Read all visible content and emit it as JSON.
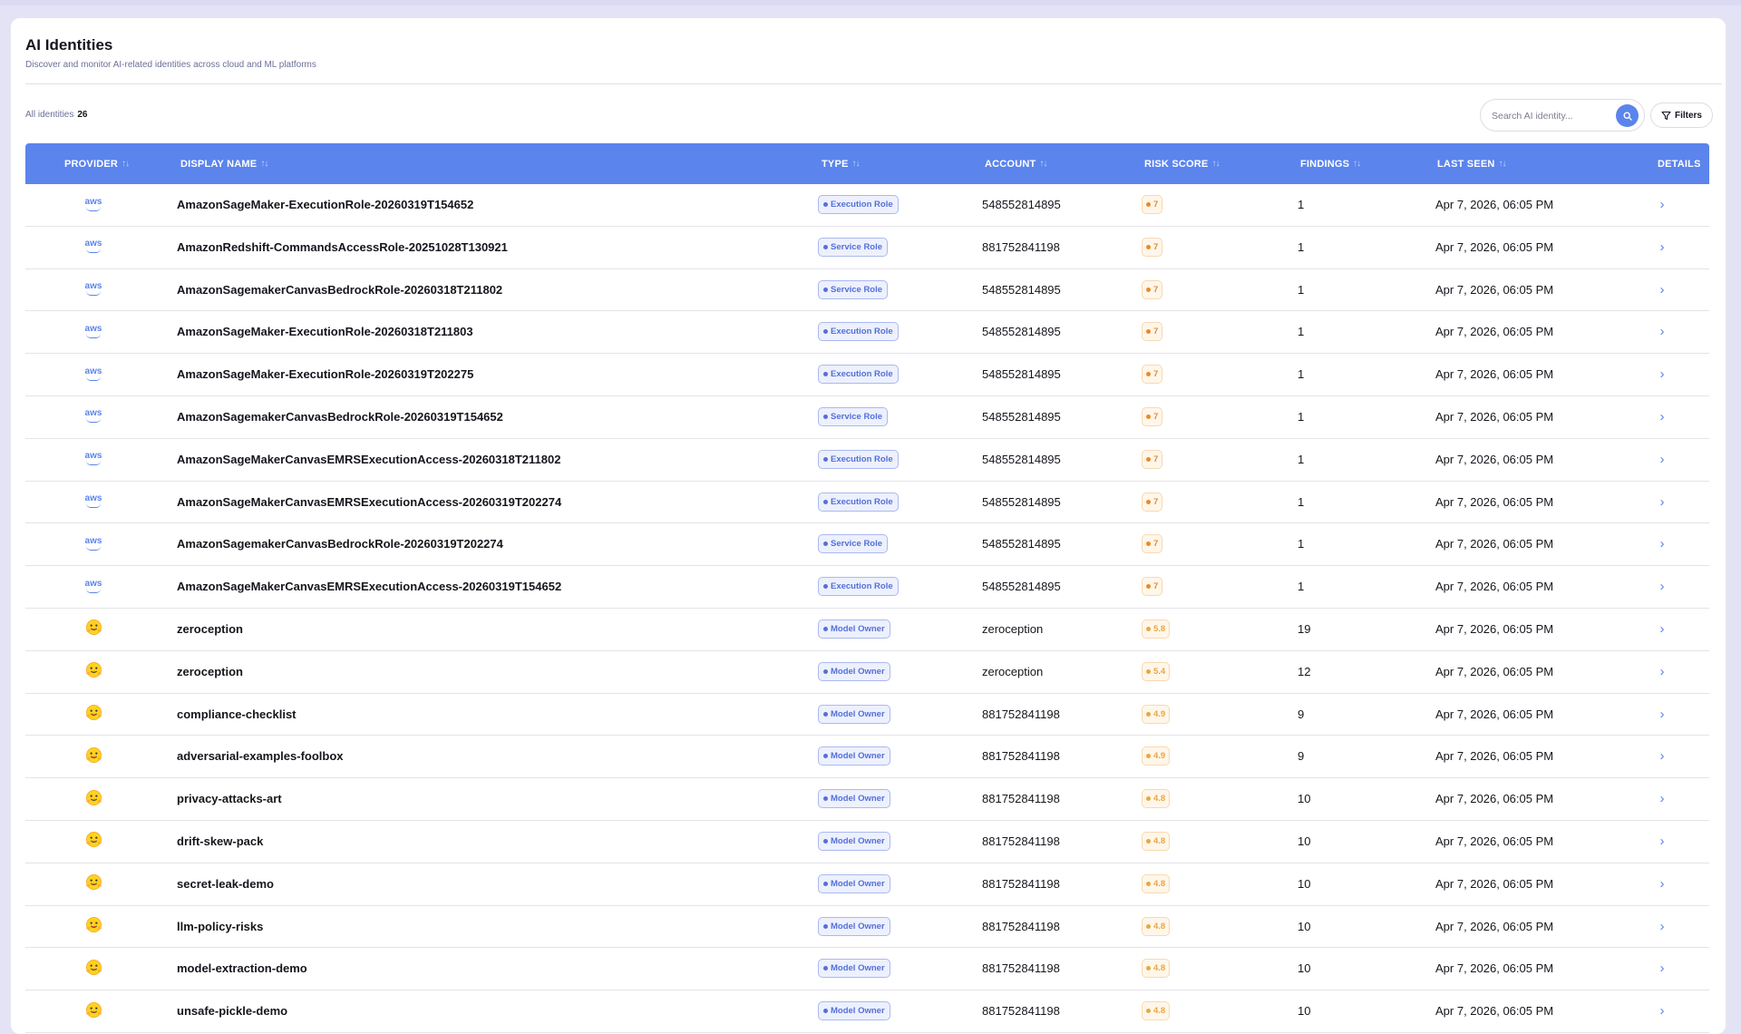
{
  "page": {
    "title": "AI Identities",
    "subtitle": "Discover and monitor AI-related identities across cloud and ML platforms"
  },
  "toolbar": {
    "count_label": "All identities",
    "count_value": "26",
    "search_placeholder": "Search AI identity...",
    "filters_label": "Filters"
  },
  "table": {
    "columns": [
      "PROVIDER",
      "DISPLAY NAME",
      "TYPE",
      "ACCOUNT",
      "RISK SCORE",
      "FINDINGS",
      "LAST SEEN",
      "DETAILS"
    ],
    "colors": {
      "header_bg": "#5b84ec",
      "type_pill": "#5470d8",
      "risk_high": "#e88b2c",
      "risk_medium": "#e6a843"
    },
    "rows": [
      {
        "provider": "aws",
        "provider_icon": "aws-logo-icon",
        "name": "AmazonSageMaker-ExecutionRole-20260319T154652",
        "type": "Execution Role",
        "account": "548552814895",
        "risk": "7",
        "risk_level": "orange",
        "findings": "1",
        "last_seen": "Apr 7, 2026, 06:05 PM"
      },
      {
        "provider": "aws",
        "provider_icon": "aws-logo-icon",
        "name": "AmazonRedshift-CommandsAccessRole-20251028T130921",
        "type": "Service Role",
        "account": "881752841198",
        "risk": "7",
        "risk_level": "orange",
        "findings": "1",
        "last_seen": "Apr 7, 2026, 06:05 PM"
      },
      {
        "provider": "aws",
        "provider_icon": "aws-logo-icon",
        "name": "AmazonSagemakerCanvasBedrockRole-20260318T211802",
        "type": "Service Role",
        "account": "548552814895",
        "risk": "7",
        "risk_level": "orange",
        "findings": "1",
        "last_seen": "Apr 7, 2026, 06:05 PM"
      },
      {
        "provider": "aws",
        "provider_icon": "aws-logo-icon",
        "name": "AmazonSageMaker-ExecutionRole-20260318T211803",
        "type": "Execution Role",
        "account": "548552814895",
        "risk": "7",
        "risk_level": "orange",
        "findings": "1",
        "last_seen": "Apr 7, 2026, 06:05 PM"
      },
      {
        "provider": "aws",
        "provider_icon": "aws-logo-icon",
        "name": "AmazonSageMaker-ExecutionRole-20260319T202275",
        "type": "Execution Role",
        "account": "548552814895",
        "risk": "7",
        "risk_level": "orange",
        "findings": "1",
        "last_seen": "Apr 7, 2026, 06:05 PM"
      },
      {
        "provider": "aws",
        "provider_icon": "aws-logo-icon",
        "name": "AmazonSagemakerCanvasBedrockRole-20260319T154652",
        "type": "Service Role",
        "account": "548552814895",
        "risk": "7",
        "risk_level": "orange",
        "findings": "1",
        "last_seen": "Apr 7, 2026, 06:05 PM"
      },
      {
        "provider": "aws",
        "provider_icon": "aws-logo-icon",
        "name": "AmazonSageMakerCanvasEMRSExecutionAccess-20260318T211802",
        "type": "Execution Role",
        "account": "548552814895",
        "risk": "7",
        "risk_level": "orange",
        "findings": "1",
        "last_seen": "Apr 7, 2026, 06:05 PM"
      },
      {
        "provider": "aws",
        "provider_icon": "aws-logo-icon",
        "name": "AmazonSageMakerCanvasEMRSExecutionAccess-20260319T202274",
        "type": "Execution Role",
        "account": "548552814895",
        "risk": "7",
        "risk_level": "orange",
        "findings": "1",
        "last_seen": "Apr 7, 2026, 06:05 PM"
      },
      {
        "provider": "aws",
        "provider_icon": "aws-logo-icon",
        "name": "AmazonSagemakerCanvasBedrockRole-20260319T202274",
        "type": "Service Role",
        "account": "548552814895",
        "risk": "7",
        "risk_level": "orange",
        "findings": "1",
        "last_seen": "Apr 7, 2026, 06:05 PM"
      },
      {
        "provider": "aws",
        "provider_icon": "aws-logo-icon",
        "name": "AmazonSageMakerCanvasEMRSExecutionAccess-20260319T154652",
        "type": "Execution Role",
        "account": "548552814895",
        "risk": "7",
        "risk_level": "orange",
        "findings": "1",
        "last_seen": "Apr 7, 2026, 06:05 PM"
      },
      {
        "provider": "huggingface",
        "provider_icon": "hugging-face-icon",
        "name": "zeroception",
        "type": "Model Owner",
        "account": "zeroception",
        "risk": "5.8",
        "risk_level": "amber",
        "findings": "19",
        "last_seen": "Apr 7, 2026, 06:05 PM"
      },
      {
        "provider": "huggingface",
        "provider_icon": "hugging-face-icon",
        "name": "zeroception",
        "type": "Model Owner",
        "account": "zeroception",
        "risk": "5.4",
        "risk_level": "amber",
        "findings": "12",
        "last_seen": "Apr 7, 2026, 06:05 PM"
      },
      {
        "provider": "huggingface",
        "provider_icon": "hugging-face-icon",
        "name": "compliance-checklist",
        "type": "Model Owner",
        "account": "881752841198",
        "risk": "4.9",
        "risk_level": "amber",
        "findings": "9",
        "last_seen": "Apr 7, 2026, 06:05 PM"
      },
      {
        "provider": "huggingface",
        "provider_icon": "hugging-face-icon",
        "name": "adversarial-examples-foolbox",
        "type": "Model Owner",
        "account": "881752841198",
        "risk": "4.9",
        "risk_level": "amber",
        "findings": "9",
        "last_seen": "Apr 7, 2026, 06:05 PM"
      },
      {
        "provider": "huggingface",
        "provider_icon": "hugging-face-icon",
        "name": "privacy-attacks-art",
        "type": "Model Owner",
        "account": "881752841198",
        "risk": "4.8",
        "risk_level": "amber",
        "findings": "10",
        "last_seen": "Apr 7, 2026, 06:05 PM"
      },
      {
        "provider": "huggingface",
        "provider_icon": "hugging-face-icon",
        "name": "drift-skew-pack",
        "type": "Model Owner",
        "account": "881752841198",
        "risk": "4.8",
        "risk_level": "amber",
        "findings": "10",
        "last_seen": "Apr 7, 2026, 06:05 PM"
      },
      {
        "provider": "huggingface",
        "provider_icon": "hugging-face-icon",
        "name": "secret-leak-demo",
        "type": "Model Owner",
        "account": "881752841198",
        "risk": "4.8",
        "risk_level": "amber",
        "findings": "10",
        "last_seen": "Apr 7, 2026, 06:05 PM"
      },
      {
        "provider": "huggingface",
        "provider_icon": "hugging-face-icon",
        "name": "llm-policy-risks",
        "type": "Model Owner",
        "account": "881752841198",
        "risk": "4.8",
        "risk_level": "amber",
        "findings": "10",
        "last_seen": "Apr 7, 2026, 06:05 PM"
      },
      {
        "provider": "huggingface",
        "provider_icon": "hugging-face-icon",
        "name": "model-extraction-demo",
        "type": "Model Owner",
        "account": "881752841198",
        "risk": "4.8",
        "risk_level": "amber",
        "findings": "10",
        "last_seen": "Apr 7, 2026, 06:05 PM"
      },
      {
        "provider": "huggingface",
        "provider_icon": "hugging-face-icon",
        "name": "unsafe-pickle-demo",
        "type": "Model Owner",
        "account": "881752841198",
        "risk": "4.8",
        "risk_level": "amber",
        "findings": "10",
        "last_seen": "Apr 7, 2026, 06:05 PM"
      }
    ]
  }
}
